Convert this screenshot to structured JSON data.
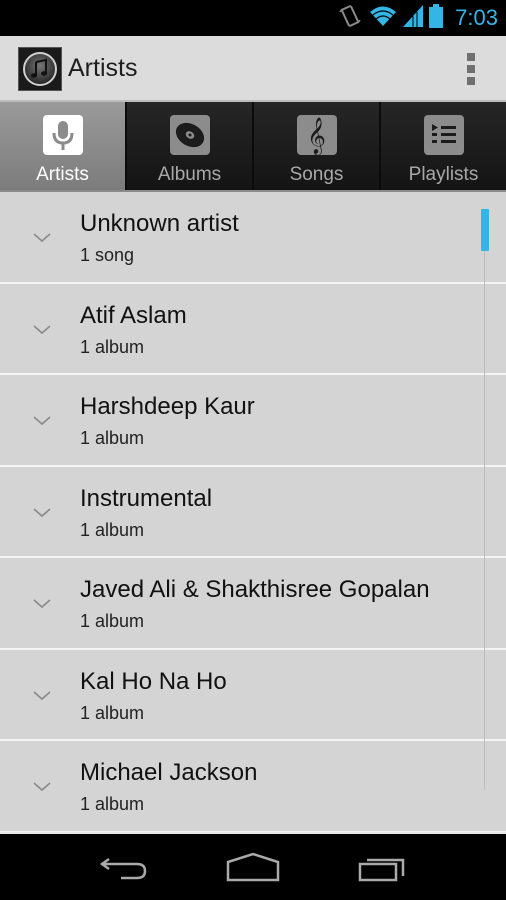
{
  "status_bar": {
    "icons": [
      "rotate-icon",
      "wifi-icon",
      "signal-icon",
      "battery-icon"
    ],
    "time": "7:03",
    "accent_color": "#33b5e5"
  },
  "action_bar": {
    "app_icon": "music-note-icon",
    "title": "Artists",
    "overflow_icon": "overflow-menu-icon"
  },
  "tabs": [
    {
      "label": "Artists",
      "icon": "microphone-icon",
      "active": true
    },
    {
      "label": "Albums",
      "icon": "album-disc-icon",
      "active": false
    },
    {
      "label": "Songs",
      "icon": "treble-clef-icon",
      "active": false
    },
    {
      "label": "Playlists",
      "icon": "playlist-icon",
      "active": false
    }
  ],
  "artists": [
    {
      "name": "Unknown artist",
      "detail": "1 song"
    },
    {
      "name": "Atif Aslam",
      "detail": "1 album"
    },
    {
      "name": "Harshdeep Kaur",
      "detail": "1 album"
    },
    {
      "name": "Instrumental",
      "detail": "1 album"
    },
    {
      "name": "Javed Ali & Shakthisree Gopalan",
      "detail": "1 album"
    },
    {
      "name": "Kal Ho Na Ho",
      "detail": "1 album"
    },
    {
      "name": "Michael Jackson",
      "detail": "1 album"
    }
  ],
  "nav_bar": {
    "buttons": [
      "back-icon",
      "home-icon",
      "recent-apps-icon"
    ]
  }
}
